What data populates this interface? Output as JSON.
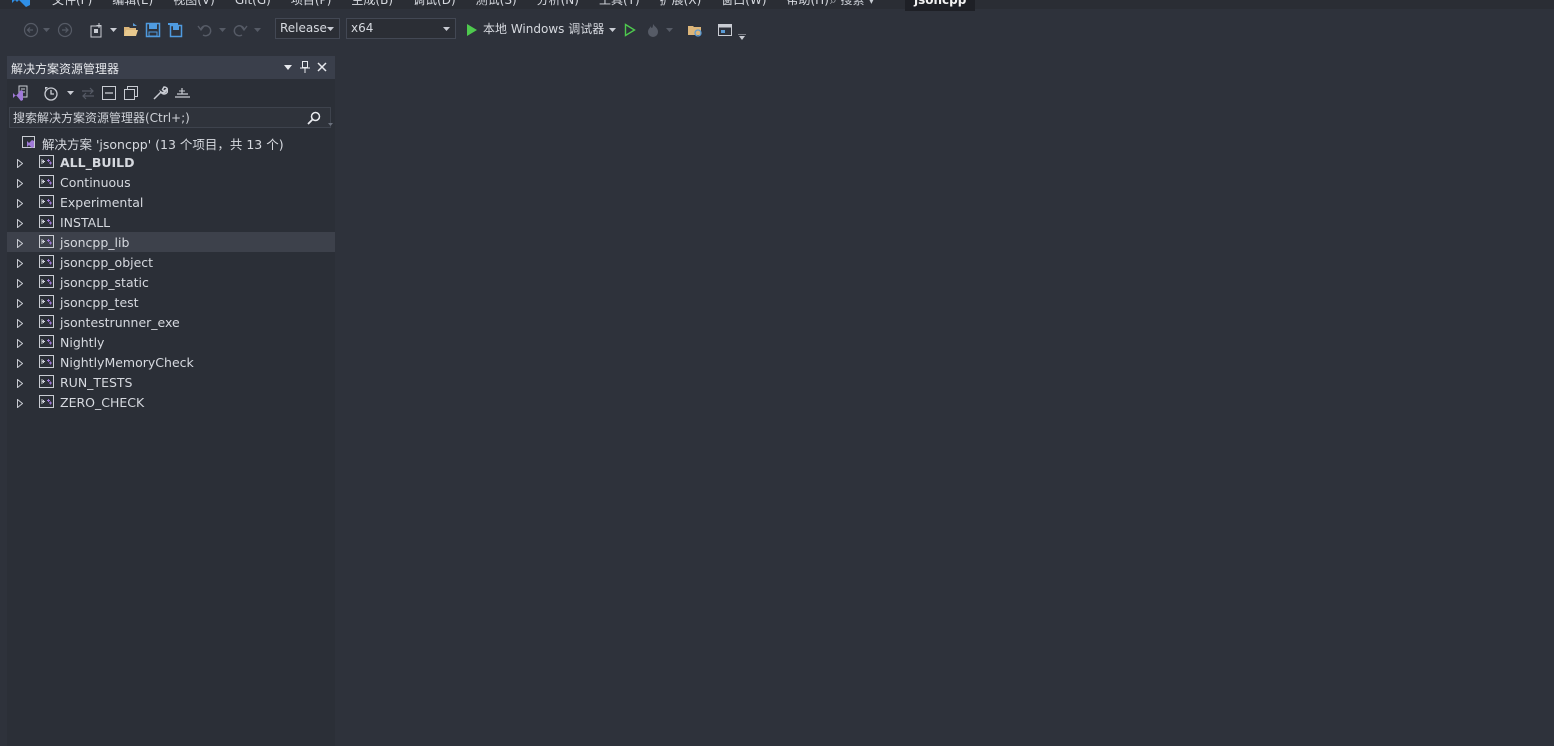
{
  "menubar": {
    "items": [
      "文件(F)",
      "编辑(E)",
      "视图(V)",
      "Git(G)",
      "项目(P)",
      "生成(B)",
      "调试(D)",
      "测试(S)",
      "分析(N)",
      "工具(T)",
      "扩展(X)",
      "窗口(W)",
      "帮助(H)"
    ],
    "search_label": "搜索",
    "solution_title": "jsoncpp"
  },
  "toolbar": {
    "configuration": "Release",
    "platform": "x64",
    "debugger_label": "本地 Windows 调试器"
  },
  "explorer": {
    "title": "解决方案资源管理器",
    "search_placeholder": "搜索解决方案资源管理器(Ctrl+;)",
    "solution_label": "解决方案 'jsoncpp' (13 个项目，共 13 个)",
    "projects": [
      {
        "name": "ALL_BUILD",
        "bold": true,
        "selected": false
      },
      {
        "name": "Continuous",
        "bold": false,
        "selected": false
      },
      {
        "name": "Experimental",
        "bold": false,
        "selected": false
      },
      {
        "name": "INSTALL",
        "bold": false,
        "selected": false
      },
      {
        "name": "jsoncpp_lib",
        "bold": false,
        "selected": true
      },
      {
        "name": "jsoncpp_object",
        "bold": false,
        "selected": false
      },
      {
        "name": "jsoncpp_static",
        "bold": false,
        "selected": false
      },
      {
        "name": "jsoncpp_test",
        "bold": false,
        "selected": false
      },
      {
        "name": "jsontestrunner_exe",
        "bold": false,
        "selected": false
      },
      {
        "name": "Nightly",
        "bold": false,
        "selected": false
      },
      {
        "name": "NightlyMemoryCheck",
        "bold": false,
        "selected": false
      },
      {
        "name": "RUN_TESTS",
        "bold": false,
        "selected": false
      },
      {
        "name": "ZERO_CHECK",
        "bold": false,
        "selected": false
      }
    ]
  },
  "colors": {
    "background": "#2e323b",
    "panel": "#2b2f37",
    "panel_title": "#3a3f4b",
    "selection": "#3d414b",
    "run_green": "#4ec94e",
    "vs_purple": "#a07ad8"
  },
  "icons": {
    "logo": "visual-studio-logo-icon",
    "project": "cpp-project-icon",
    "solution": "solution-icon"
  }
}
